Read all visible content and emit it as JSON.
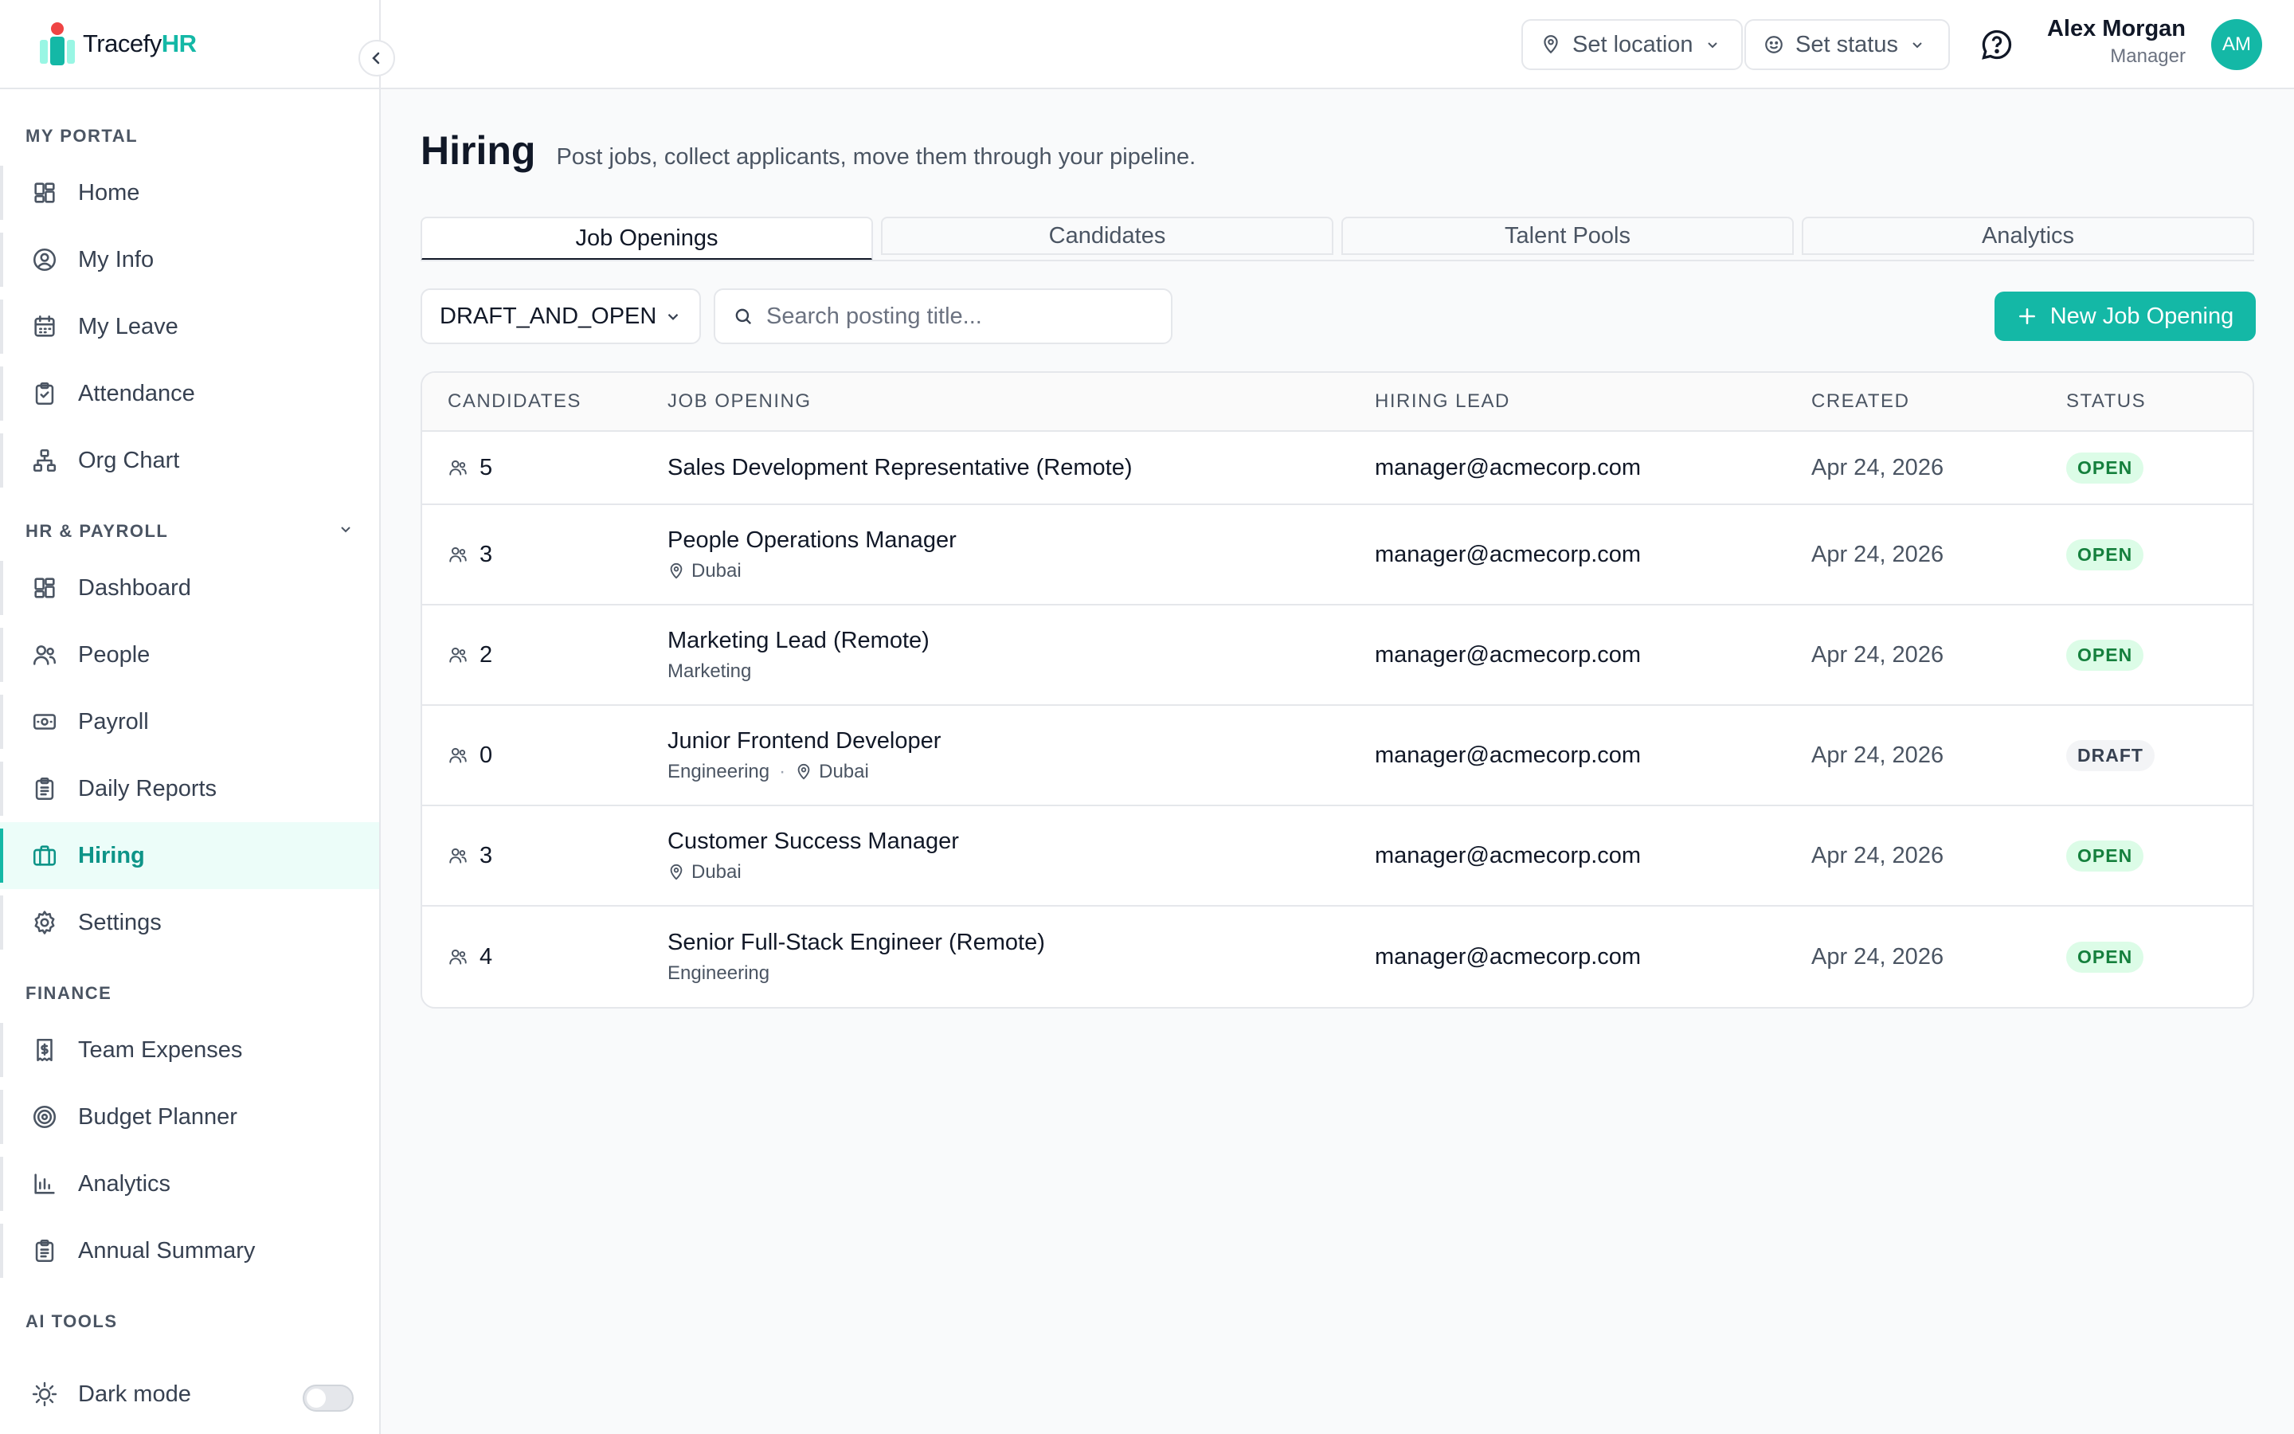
{
  "app": {
    "brand_prefix": "Tracefy",
    "brand_suffix": "HR"
  },
  "sidebar": {
    "sections": [
      {
        "label": "MY PORTAL",
        "items": [
          {
            "label": "Home",
            "icon": "grid-icon"
          },
          {
            "label": "My Info",
            "icon": "user-circle-icon"
          },
          {
            "label": "My Leave",
            "icon": "calendar-icon"
          },
          {
            "label": "Attendance",
            "icon": "clipboard-check-icon"
          },
          {
            "label": "Org Chart",
            "icon": "org-chart-icon"
          }
        ]
      },
      {
        "label": "HR & PAYROLL",
        "items": [
          {
            "label": "Dashboard",
            "icon": "grid-icon"
          },
          {
            "label": "People",
            "icon": "users-icon"
          },
          {
            "label": "Payroll",
            "icon": "banknote-icon"
          },
          {
            "label": "Daily Reports",
            "icon": "clipboard-list-icon"
          },
          {
            "label": "Hiring",
            "icon": "briefcase-icon",
            "active": true
          },
          {
            "label": "Settings",
            "icon": "gear-icon"
          }
        ]
      },
      {
        "label": "FINANCE",
        "items": [
          {
            "label": "Team Expenses",
            "icon": "receipt-icon"
          },
          {
            "label": "Budget Planner",
            "icon": "target-icon"
          },
          {
            "label": "Analytics",
            "icon": "bar-chart-icon"
          },
          {
            "label": "Annual Summary",
            "icon": "clipboard-list-icon"
          }
        ]
      },
      {
        "label": "AI TOOLS",
        "items": []
      }
    ],
    "dark_mode_label": "Dark mode",
    "dark_mode_on": false
  },
  "header": {
    "location_label": "Set location",
    "status_label": "Set status",
    "user_name": "Alex Morgan",
    "user_role": "Manager",
    "avatar_initials": "AM"
  },
  "main": {
    "title": "Hiring",
    "subtitle": "Post jobs, collect applicants, move them through your pipeline.",
    "tabs": [
      "Job Openings",
      "Candidates",
      "Talent Pools",
      "Analytics"
    ],
    "active_tab": 0,
    "filter_value": "DRAFT_AND_OPEN",
    "search_placeholder": "Search posting title...",
    "new_button": "New Job Opening",
    "columns": [
      "CANDIDATES",
      "JOB OPENING",
      "HIRING LEAD",
      "CREATED",
      "STATUS"
    ],
    "rows": [
      {
        "candidates": "5",
        "title": "Sales Development Representative (Remote)",
        "department": "",
        "location": "",
        "lead": "manager@acmecorp.com",
        "created": "Apr 24, 2026",
        "status": "OPEN"
      },
      {
        "candidates": "3",
        "title": "People Operations Manager",
        "department": "",
        "location": "Dubai",
        "lead": "manager@acmecorp.com",
        "created": "Apr 24, 2026",
        "status": "OPEN"
      },
      {
        "candidates": "2",
        "title": "Marketing Lead (Remote)",
        "department": "Marketing",
        "location": "",
        "lead": "manager@acmecorp.com",
        "created": "Apr 24, 2026",
        "status": "OPEN"
      },
      {
        "candidates": "0",
        "title": "Junior Frontend Developer",
        "department": "Engineering",
        "location": "Dubai",
        "lead": "manager@acmecorp.com",
        "created": "Apr 24, 2026",
        "status": "DRAFT"
      },
      {
        "candidates": "3",
        "title": "Customer Success Manager",
        "department": "",
        "location": "Dubai",
        "lead": "manager@acmecorp.com",
        "created": "Apr 24, 2026",
        "status": "OPEN"
      },
      {
        "candidates": "4",
        "title": "Senior Full-Stack Engineer (Remote)",
        "department": "Engineering",
        "location": "",
        "lead": "manager@acmecorp.com",
        "created": "Apr 24, 2026",
        "status": "OPEN"
      }
    ]
  },
  "colors": {
    "accent": "#14b8a6",
    "active_bg": "#ecfdf9",
    "open_badge": "#dcfce7",
    "draft_badge": "#f3f4f6"
  }
}
